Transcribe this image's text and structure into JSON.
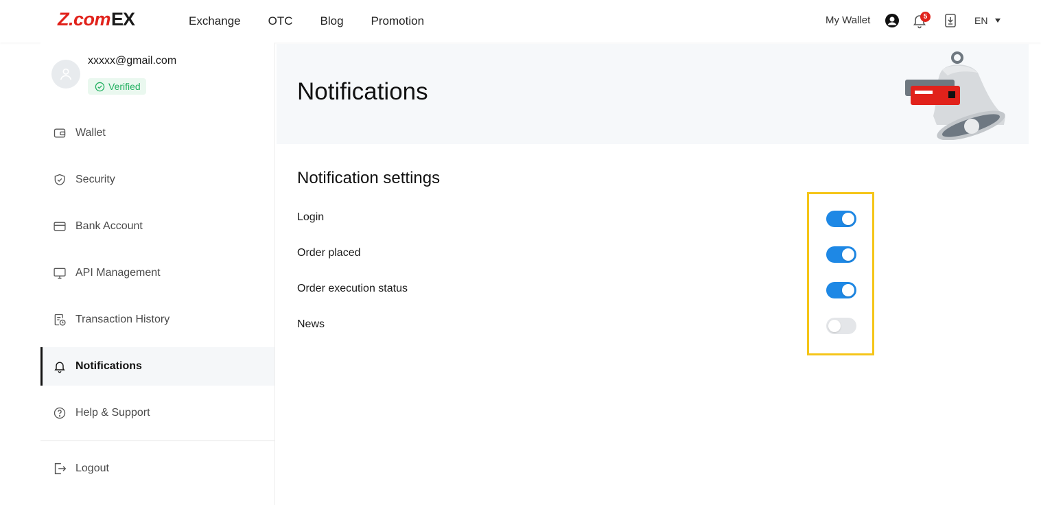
{
  "header": {
    "logo_text": "Z.com",
    "logo_suffix": "EX",
    "nav": [
      {
        "label": "Exchange"
      },
      {
        "label": "OTC"
      },
      {
        "label": "Blog"
      },
      {
        "label": "Promotion"
      }
    ],
    "my_wallet": "My Wallet",
    "notification_count": "5",
    "language": "EN"
  },
  "profile": {
    "email": "xxxxx@gmail.com",
    "status": "Verified"
  },
  "sidebar": {
    "items": [
      {
        "label": "Wallet",
        "icon": "wallet-icon",
        "active": false
      },
      {
        "label": "Security",
        "icon": "shield-icon",
        "active": false
      },
      {
        "label": "Bank Account",
        "icon": "card-icon",
        "active": false
      },
      {
        "label": "API Management",
        "icon": "monitor-icon",
        "active": false
      },
      {
        "label": "Transaction History",
        "icon": "history-icon",
        "active": false
      },
      {
        "label": "Notifications",
        "icon": "bell-icon",
        "active": true
      },
      {
        "label": "Help & Support",
        "icon": "help-icon",
        "active": false
      }
    ],
    "logout": "Logout"
  },
  "main": {
    "title": "Notifications",
    "section_title": "Notification settings",
    "settings": [
      {
        "label": "Login",
        "enabled": true
      },
      {
        "label": "Order placed",
        "enabled": true
      },
      {
        "label": "Order execution status",
        "enabled": true
      },
      {
        "label": "News",
        "enabled": false
      }
    ]
  },
  "colors": {
    "brand_red": "#e1221b",
    "toggle_on": "#1e88e5",
    "toggle_off": "#e4e6e9",
    "highlight": "#f5c518",
    "verified_green": "#22b060"
  }
}
